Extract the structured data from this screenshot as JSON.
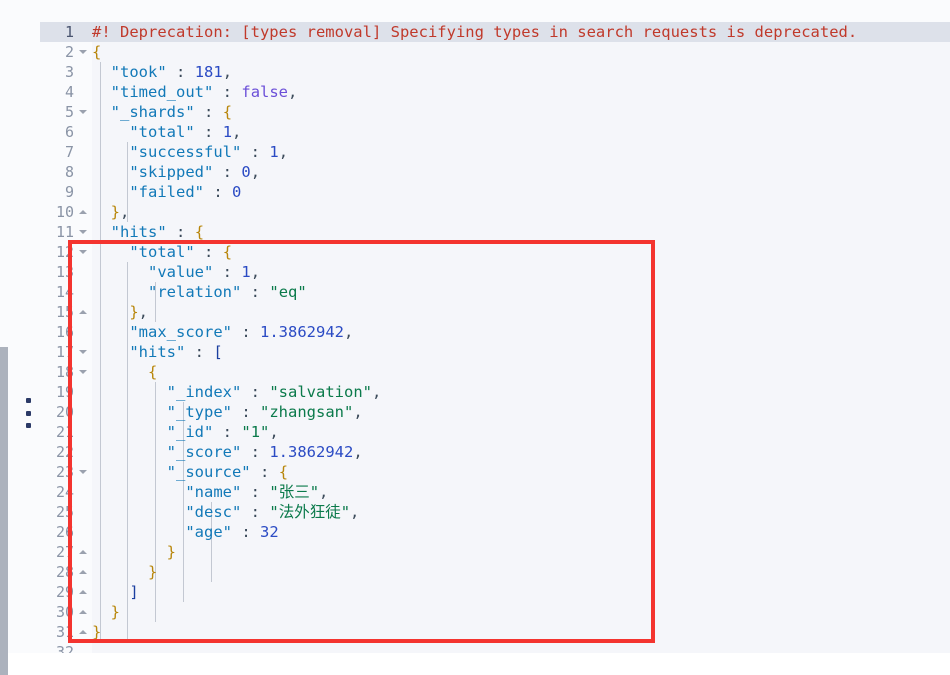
{
  "window": {
    "app": "json-response-viewer",
    "background": "#f5f6fa",
    "accent": "#f4342f"
  },
  "editor": {
    "language": "json",
    "active_line": 1,
    "first_visible_line": 1,
    "last_visible_line": 31,
    "lines": [
      {
        "n": "1",
        "fold": "",
        "active": true,
        "text": "#! Deprecation: [types removal] Specifying types in search requests is deprecated."
      },
      {
        "n": "2",
        "fold": "down",
        "active": false,
        "text": "{"
      },
      {
        "n": "3",
        "fold": "",
        "active": false,
        "text": "  \"took\" : 181,"
      },
      {
        "n": "4",
        "fold": "",
        "active": false,
        "text": "  \"timed_out\" : false,"
      },
      {
        "n": "5",
        "fold": "down",
        "active": false,
        "text": "  \"_shards\" : {"
      },
      {
        "n": "6",
        "fold": "",
        "active": false,
        "text": "    \"total\" : 1,"
      },
      {
        "n": "7",
        "fold": "",
        "active": false,
        "text": "    \"successful\" : 1,"
      },
      {
        "n": "8",
        "fold": "",
        "active": false,
        "text": "    \"skipped\" : 0,"
      },
      {
        "n": "9",
        "fold": "",
        "active": false,
        "text": "    \"failed\" : 0"
      },
      {
        "n": "10",
        "fold": "up",
        "active": false,
        "text": "  },"
      },
      {
        "n": "11",
        "fold": "down",
        "active": false,
        "text": "  \"hits\" : {"
      },
      {
        "n": "12",
        "fold": "down",
        "active": false,
        "text": "    \"total\" : {"
      },
      {
        "n": "13",
        "fold": "",
        "active": false,
        "text": "      \"value\" : 1,"
      },
      {
        "n": "14",
        "fold": "",
        "active": false,
        "text": "      \"relation\" : \"eq\""
      },
      {
        "n": "15",
        "fold": "up",
        "active": false,
        "text": "    },"
      },
      {
        "n": "16",
        "fold": "",
        "active": false,
        "text": "    \"max_score\" : 1.3862942,"
      },
      {
        "n": "17",
        "fold": "down",
        "active": false,
        "text": "    \"hits\" : ["
      },
      {
        "n": "18",
        "fold": "down",
        "active": false,
        "text": "      {"
      },
      {
        "n": "19",
        "fold": "",
        "active": false,
        "text": "        \"_index\" : \"salvation\","
      },
      {
        "n": "20",
        "fold": "",
        "active": false,
        "text": "        \"_type\" : \"zhangsan\","
      },
      {
        "n": "21",
        "fold": "",
        "active": false,
        "text": "        \"_id\" : \"1\","
      },
      {
        "n": "22",
        "fold": "",
        "active": false,
        "text": "        \"_score\" : 1.3862942,"
      },
      {
        "n": "23",
        "fold": "down",
        "active": false,
        "text": "        \"_source\" : {"
      },
      {
        "n": "24",
        "fold": "",
        "active": false,
        "text": "          \"name\" : \"张三\","
      },
      {
        "n": "25",
        "fold": "",
        "active": false,
        "text": "          \"desc\" : \"法外狂徒\","
      },
      {
        "n": "26",
        "fold": "",
        "active": false,
        "text": "          \"age\" : 32"
      },
      {
        "n": "27",
        "fold": "up",
        "active": false,
        "text": "        }"
      },
      {
        "n": "28",
        "fold": "up",
        "active": false,
        "text": "      }"
      },
      {
        "n": "29",
        "fold": "up",
        "active": false,
        "text": "    ]"
      },
      {
        "n": "30",
        "fold": "up",
        "active": false,
        "text": "  }"
      },
      {
        "n": "31",
        "fold": "up",
        "active": false,
        "text": "}"
      }
    ]
  },
  "response_payload": {
    "took": 181,
    "timed_out": false,
    "_shards": {
      "total": 1,
      "successful": 1,
      "skipped": 0,
      "failed": 0
    },
    "hits": {
      "total": {
        "value": 1,
        "relation": "eq"
      },
      "max_score": 1.3862942,
      "hits": [
        {
          "_index": "salvation",
          "_type": "zhangsan",
          "_id": "1",
          "_score": 1.3862942,
          "_source": {
            "name": "张三",
            "desc": "法外狂徒",
            "age": 32
          }
        }
      ]
    }
  },
  "warning": {
    "text": "#! Deprecation: [types removal] Specifying types in search requests is deprecated.",
    "color": "#c0392b"
  },
  "annotation": {
    "shape": "rectangle",
    "color": "#f4342f",
    "covers_lines": "12-31"
  },
  "icons": {
    "drag_handle": "vertical-dots-drag-handle",
    "fold_down": "chevron-down-fold-icon",
    "fold_up": "chevron-up-fold-icon"
  }
}
